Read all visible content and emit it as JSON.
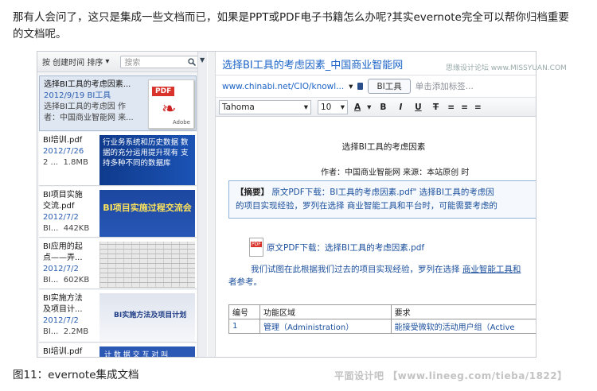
{
  "intro_text": "那有人会问了，这只是集成一些文档而已，如果是PPT或PDF电子书籍怎么办呢?其实evernote完全可以帮你归档重要的文档呢。",
  "caption": "图11：evernote集成文档",
  "watermark": "平面设计吧 【www.lineeg.com/tieba/1822】",
  "site_watermark": "思缘设计论坛 www.MISSYUAN.COM",
  "list": {
    "sort_label": "按 创建时间 排序",
    "sort_arrow": "▾",
    "search_placeholder": "搜索",
    "notes": [
      {
        "title": "选择BI工具的考虑因素...",
        "date": "2012/9/19",
        "tag": "BI工具",
        "line3": "选择BI工具的考虑因 作",
        "line4": "者：中国商业智能网 来..."
      },
      {
        "title": "BI培训.pdf",
        "date": "2012/7/26",
        "meta_left": "2 ...",
        "size": "1.8MB",
        "thumb_text": "行业务系统和历史数据 数据的充分运用提升现有 支持多种不同的数据库"
      },
      {
        "title": "BI项目实施",
        "title2": "交流.pdf",
        "date": "2012/7/2",
        "meta_left": "BI...",
        "size": "442KB",
        "thumb_text": "BI项目实施过程交流会"
      },
      {
        "title": "BI应用的起",
        "title2": "点——弄...",
        "date": "2012/7/2",
        "meta_left": "BI...",
        "size": "602KB"
      },
      {
        "title": "BI实施方法",
        "title2": "及项目计...",
        "date": "2012/7/2",
        "meta_left": "BI...",
        "size": "2.2MB",
        "thumb_text": "BI实施方法及项目计划"
      },
      {
        "title": "BI培训.pdf",
        "thumb_text": "计 数 据 交 互 对 叫"
      }
    ]
  },
  "editor": {
    "note_title": "选择BI工具的考虑因素_中国商业智能网",
    "url": "www.chinabi.net/CIO/knowl...",
    "url_arrow": "▾",
    "tag": "BI工具",
    "tag_add": "单击添加标签...",
    "font": "Tahoma",
    "font_size": "10",
    "fmt": [
      "B",
      "I",
      "U",
      "T"
    ],
    "doc_heading": "选择BI工具的考虑因素",
    "author_line": "作者：中国商业智能网     来源：本站原创      时",
    "summary_label": "【摘要】",
    "summary_l1": " 原文PDF下载：BI工具的考虑因素.pdf\" 选择BI工具的考虑因",
    "summary_l2": "的项目实现经验，罗列在选择 商业智能工具和平台时，可能需要考虑的",
    "attach_text": "原文PDF下载：选择BI工具的考虑因素.pdf",
    "para_pre": "我们试图在此根据我们过去的项目实现经验，罗列在选择 ",
    "para_link": "商业智能工具和",
    "para2": "者参考。",
    "table_header": [
      "编号",
      "功能区域",
      "要求"
    ],
    "table_row": [
      "1",
      "管理（Administration）",
      "能接受微软的活动用户组（Active"
    ]
  }
}
